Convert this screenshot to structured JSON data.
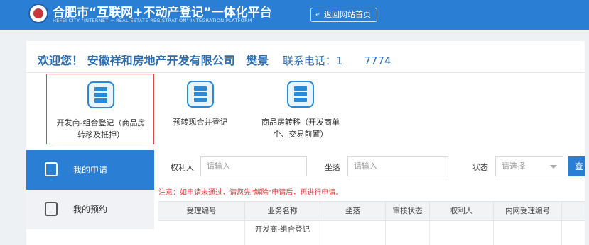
{
  "header": {
    "title": "合肥市“互联网+不动产登记”一体化平台",
    "subtitle": "HEFEI CITY \"INTERNET + REAL ESTATE REGISTRATION\" INTEGRATION PLATFORM",
    "home_button": "返回网站首页",
    "logo_icon": "city-emblem-icon",
    "accent_color": "#2a7fd4"
  },
  "welcome": {
    "greeting": "欢迎您！",
    "company": "安徽祥和",
    "company_mid": "房地产开发有限公司",
    "person": "樊",
    "person_tail": "景",
    "phone_label": "联系电话：",
    "phone_prefix": "1",
    "phone_suffix": "7774"
  },
  "services": [
    {
      "label": "开发商-组合登记（商品房转移及抵押）",
      "icon": "server-stack-icon",
      "selected": true
    },
    {
      "label": "预转现合并登记",
      "icon": "server-stack-icon",
      "selected": false
    },
    {
      "label": "商品房转移（开发商单个、交易前置）",
      "icon": "server-stack-icon",
      "selected": false
    }
  ],
  "sidebar": {
    "items": [
      {
        "label": "我的申请",
        "icon": "edit-document-icon",
        "active": true
      },
      {
        "label": "我的预约",
        "icon": "calendar-clock-icon",
        "active": false
      }
    ]
  },
  "filters": {
    "rightholder_label": "权利人",
    "rightholder_placeholder": "请输入",
    "location_label": "坐落",
    "location_placeholder": "请输入",
    "status_label": "状态",
    "status_value": "请选择",
    "search_label": "查"
  },
  "notice": "注意：如申请未通过，请您先\"解除\"申请后，再进行申请。",
  "table": {
    "columns": [
      "受理编号",
      "业务名称",
      "坐落",
      "审核状态",
      "权利人",
      "内网受理编号"
    ],
    "rows": [
      [
        "",
        "开发商-组合登记",
        "",
        "",
        "",
        ""
      ]
    ]
  }
}
